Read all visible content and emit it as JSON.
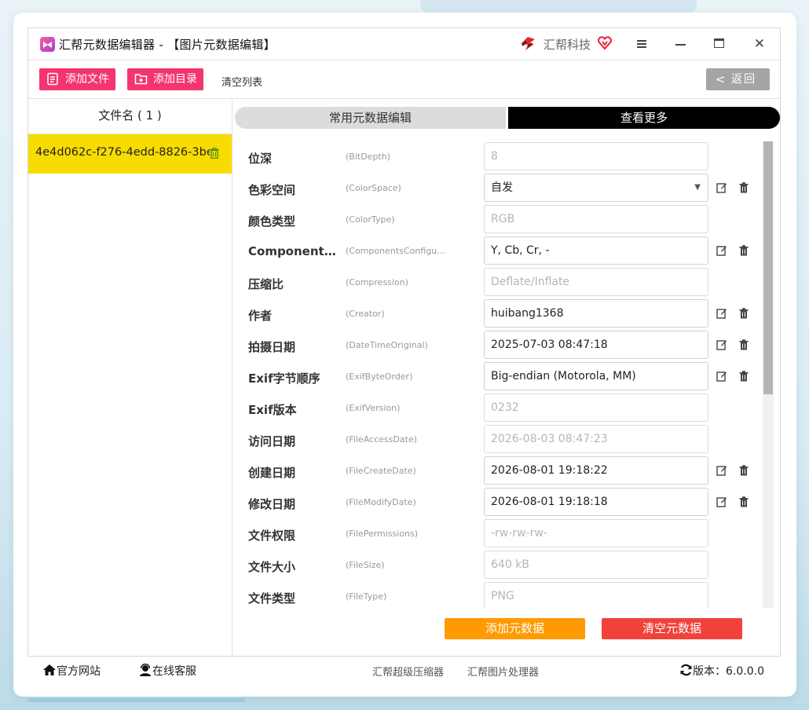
{
  "window": {
    "app_title": "汇帮元数据编辑器 - 【图片元数据编辑】",
    "brand_name": "汇帮科技"
  },
  "toolbar": {
    "add_file": "添加文件",
    "add_dir": "添加目录",
    "clear_list": "清空列表",
    "back": "返回"
  },
  "file_list": {
    "header": "文件名 ( 1 )",
    "files": [
      {
        "name": "4e4d062c-f276-4edd-8826-3be3..."
      }
    ]
  },
  "tabs": {
    "common": "常用元数据编辑",
    "more": "查看更多"
  },
  "metadata_rows": [
    {
      "label": "位深",
      "key": "(BitDepth)",
      "value": "8",
      "editable": false
    },
    {
      "label": "色彩空间",
      "key": "(ColorSpace)",
      "value": "自发",
      "editable": true,
      "dropdown": true
    },
    {
      "label": "颜色类型",
      "key": "(ColorType)",
      "value": "RGB",
      "editable": false
    },
    {
      "label": "Components...",
      "key": "(ComponentsConfigur...",
      "value": "Y, Cb, Cr, -",
      "editable": true
    },
    {
      "label": "压缩比",
      "key": "(Compression)",
      "value": "Deflate/Inflate",
      "editable": false
    },
    {
      "label": "作者",
      "key": "(Creator)",
      "value": "huibang1368",
      "editable": true
    },
    {
      "label": "拍摄日期",
      "key": "(DateTimeOriginal)",
      "value": "2025-07-03 08:47:18",
      "editable": true
    },
    {
      "label": "Exif字节顺序",
      "key": "(ExifByteOrder)",
      "value": "Big-endian (Motorola, MM)",
      "editable": true
    },
    {
      "label": "Exif版本",
      "key": "(ExifVersion)",
      "value": "0232",
      "editable": false
    },
    {
      "label": "访问日期",
      "key": "(FileAccessDate)",
      "value": "2026-08-03 08:47:23",
      "editable": false
    },
    {
      "label": "创建日期",
      "key": "(FileCreateDate)",
      "value": "2026-08-01 19:18:22",
      "editable": true
    },
    {
      "label": "修改日期",
      "key": "(FileModifyDate)",
      "value": "2026-08-01 19:18:18",
      "editable": true
    },
    {
      "label": "文件权限",
      "key": "(FilePermissions)",
      "value": "-rw-rw-rw-",
      "editable": false
    },
    {
      "label": "文件大小",
      "key": "(FileSize)",
      "value": "640 kB",
      "editable": false
    },
    {
      "label": "文件类型",
      "key": "(FileType)",
      "value": "PNG",
      "editable": false
    }
  ],
  "actions": {
    "add_meta": "添加元数据",
    "clear_meta": "清空元数据"
  },
  "footer": {
    "website": "官方网站",
    "support": "在线客服",
    "link_compressor": "汇帮超级压缩器",
    "link_image": "汇帮图片处理器",
    "version": "版本：6.0.0.0"
  },
  "colors": {
    "accent_pink": "#f4356f",
    "selected_row": "#f6dc00",
    "add_meta": "#ff9a00",
    "clear_meta": "#f0423b"
  }
}
